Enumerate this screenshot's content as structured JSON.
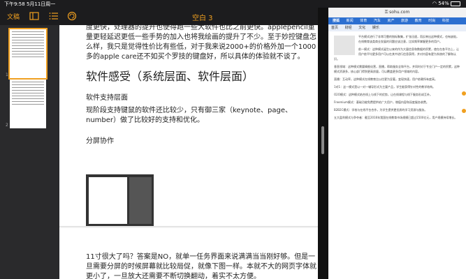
{
  "status": {
    "time_date": "下午9:58 5月11日周一",
    "battery": "54%"
  },
  "toolbar": {
    "back_label": "文稿",
    "title": "空白 3"
  },
  "sidebar": {
    "pages": [
      "1",
      "2"
    ]
  },
  "document": {
    "intro": "度更快，处理器的提升也使得跑一些大软件也比之前更快。applepencil重量更轻延迟更低一些手势的加入也将我绘画的提升了不少。至于妙控键盘怎么样，我只是觉得性价比有些低，对于我来说2000+的价格外加一个1000多的apple care还不如买个罗技的键盘好，所以具体的体验就不谈了。",
    "heading": "软件感受（系统层面、软件层面）",
    "sub1": "软件支持层面",
    "para1": "现阶段支持键鼠的软件还比较少，只有御三家（keynote、page、number）做了比较好的支持和优化。",
    "sub2": "分屏协作",
    "para2": "11寸很大了吗？答案是NO，就单一任务界面来说满满当当刚好够。但是一旦需要分屏的时候屏幕就比较局促，就像下图一样。本就不大的网页字体就更小了，一旦放大还需要不断切换翻动，着实不太方便。"
  },
  "browser": {
    "url": "sohu.com",
    "nav_logo": "搜狐",
    "nav_items": [
      "新闻",
      "体育",
      "汽车",
      "房产",
      "旅游",
      "教育",
      "时尚",
      "科技"
    ],
    "tabs": [
      "首页",
      "财经",
      "文化",
      "娱乐"
    ],
    "article_paras": [
      "平台模式进行了非常可靠的指标聚集，扩张迅速，而反映出这种模式，也有缺陷，在线教育该类商业发展的问题应该注意，比如频率掌握更多的用户。",
      "前一模式：这种模式诞生以来的作为大量信息和数据的积累，使在在各平台上，让用户依平均更多用户可以在其中进行信息获得，并对内容有更为系统的了解和认识。",
      "垂直领域：这种模式需要精细化营，直播，帮助服务全和平台，并同时对于专业门户一定的积累，这种模式资源多，核心部门得到更高质量，可以覆盖更多用户领域的内容。",
      "直播：互动率，这种模式在线教育比以往更为显著，变现快速，用户依赖所有度高。",
      "1对1：这一模式是以一对一辅导形式为主要产品，学生能获得针对性的教学结构。",
      "O2O模式：这种模式结合线上与线下的优势，让在线课程与线下服务形成互补。",
      "Freemium模式：基础功能免费提供给广大用户，增值内容和深度服务收费。",
      "B2B2C模式：学校与在线平台合作，为学生提供更优质的学习资源与服务。",
      "五大盈利模式与争夺者：截至2016年我国在线教育市场规模已超过1500亿元，用户规模持续增长。"
    ]
  }
}
